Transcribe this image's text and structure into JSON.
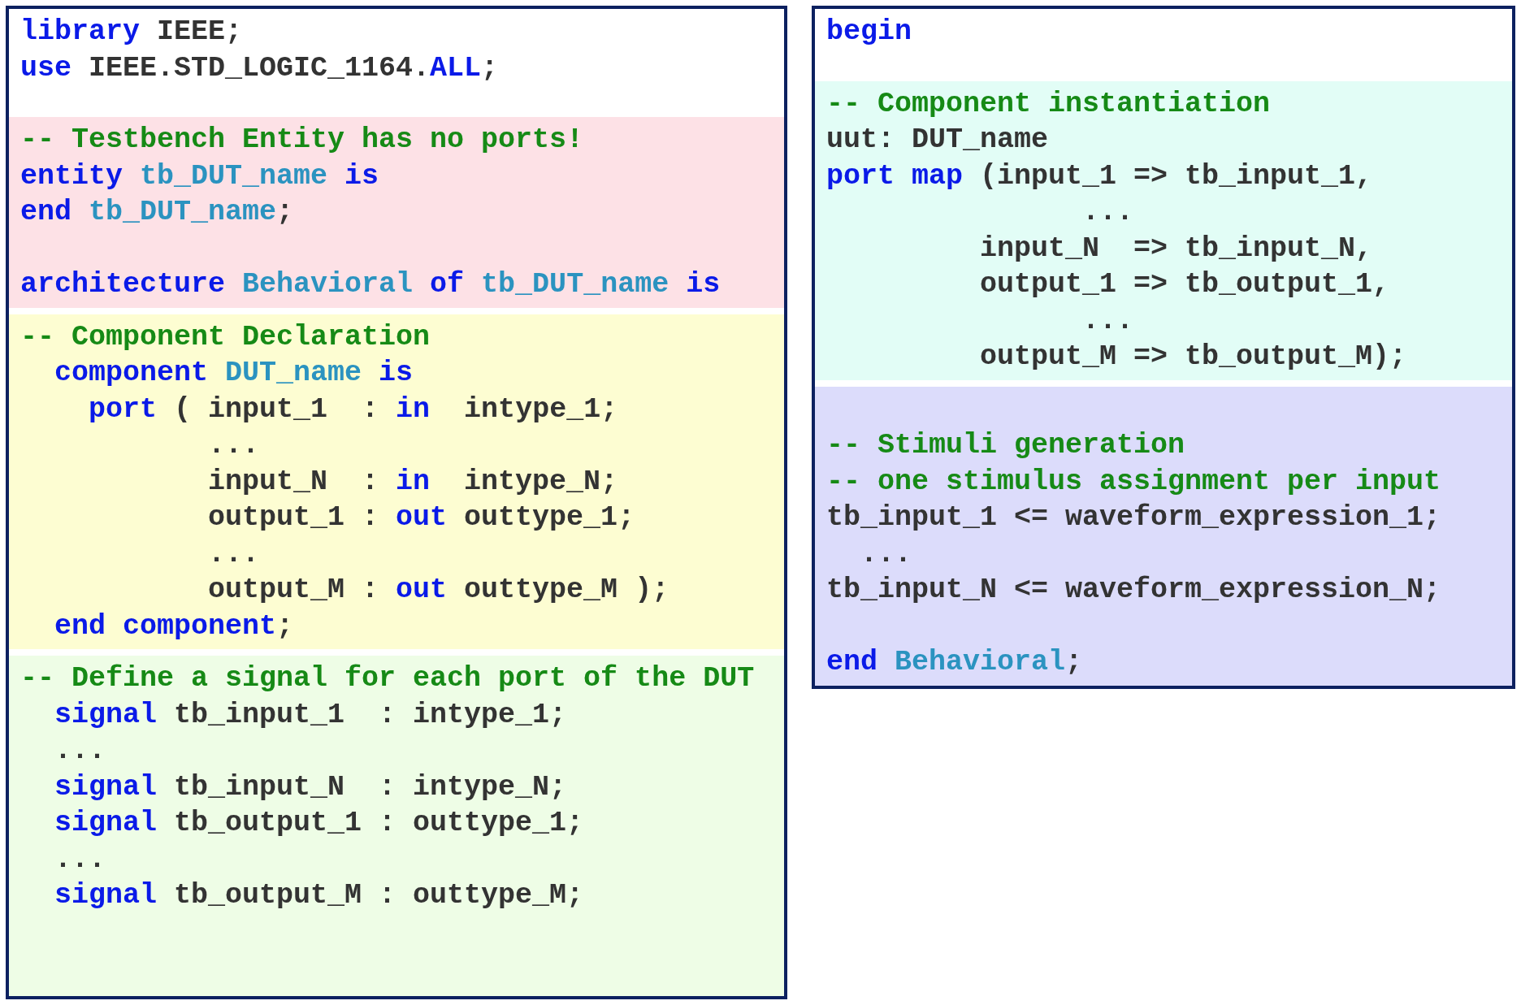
{
  "panels": [
    {
      "sections": [
        {
          "color": "#ffffff",
          "lines": [
            {
              "tokens": [
                {
                  "kind": "keyword",
                  "t": "library "
                },
                {
                  "kind": "text",
                  "t": "IEEE;"
                }
              ]
            },
            {
              "tokens": [
                {
                  "kind": "keyword",
                  "t": "use "
                },
                {
                  "kind": "text",
                  "t": "IEEE.STD_LOGIC_1164."
                },
                {
                  "kind": "keyword",
                  "t": "ALL"
                },
                {
                  "kind": "text",
                  "t": ";"
                }
              ]
            }
          ]
        },
        {
          "color": "#fde1e6",
          "lines": [
            {
              "tokens": [
                {
                  "kind": "comment",
                  "t": "-- Testbench Entity has no ports!"
                }
              ]
            },
            {
              "tokens": [
                {
                  "kind": "keyword",
                  "t": "entity "
                },
                {
                  "kind": "identifier",
                  "t": "tb_DUT_name "
                },
                {
                  "kind": "keyword",
                  "t": "is"
                }
              ]
            },
            {
              "tokens": [
                {
                  "kind": "keyword",
                  "t": "end "
                },
                {
                  "kind": "identifier",
                  "t": "tb_DUT_name"
                },
                {
                  "kind": "text",
                  "t": ";"
                }
              ]
            },
            {
              "space_before": true,
              "tokens": [
                {
                  "kind": "keyword",
                  "t": "architecture "
                },
                {
                  "kind": "identifier",
                  "t": "Behavioral "
                },
                {
                  "kind": "keyword",
                  "t": "of "
                },
                {
                  "kind": "identifier",
                  "t": "tb_DUT_name "
                },
                {
                  "kind": "keyword",
                  "t": "is"
                }
              ]
            }
          ]
        },
        {
          "color": "#fdfdd2",
          "lines": [
            {
              "tokens": [
                {
                  "kind": "comment",
                  "t": "-- Component Declaration"
                }
              ]
            },
            {
              "tokens": [
                {
                  "kind": "keyword",
                  "t": "  component "
                },
                {
                  "kind": "identifier",
                  "t": "DUT_name "
                },
                {
                  "kind": "keyword",
                  "t": "is"
                }
              ]
            },
            {
              "tokens": [
                {
                  "kind": "keyword",
                  "t": "    port"
                },
                {
                  "kind": "text",
                  "t": " ( input_1  : "
                },
                {
                  "kind": "keyword",
                  "t": "in"
                },
                {
                  "kind": "text",
                  "t": "  intype_1;"
                }
              ]
            },
            {
              "tokens": [
                {
                  "kind": "text",
                  "t": "           ..."
                }
              ]
            },
            {
              "tokens": [
                {
                  "kind": "text",
                  "t": "           input_N  : "
                },
                {
                  "kind": "keyword",
                  "t": "in"
                },
                {
                  "kind": "text",
                  "t": "  intype_N;"
                }
              ]
            },
            {
              "tokens": [
                {
                  "kind": "text",
                  "t": "           output_1 : "
                },
                {
                  "kind": "keyword",
                  "t": "out"
                },
                {
                  "kind": "text",
                  "t": " outtype_1;"
                }
              ]
            },
            {
              "tokens": [
                {
                  "kind": "text",
                  "t": "           ..."
                }
              ]
            },
            {
              "tokens": [
                {
                  "kind": "text",
                  "t": "           output_M : "
                },
                {
                  "kind": "keyword",
                  "t": "out"
                },
                {
                  "kind": "text",
                  "t": " outtype_M );"
                }
              ]
            },
            {
              "tokens": [
                {
                  "kind": "keyword",
                  "t": "  end component"
                },
                {
                  "kind": "text",
                  "t": ";"
                }
              ]
            }
          ]
        },
        {
          "color": "#eefde6",
          "lines": [
            {
              "tokens": [
                {
                  "kind": "comment",
                  "t": "-- Define a signal for each port of the DUT"
                }
              ]
            },
            {
              "tokens": [
                {
                  "kind": "keyword",
                  "t": "  signal"
                },
                {
                  "kind": "text",
                  "t": " tb_input_1  : intype_1;"
                }
              ]
            },
            {
              "tokens": [
                {
                  "kind": "text",
                  "t": "  ..."
                }
              ]
            },
            {
              "tokens": [
                {
                  "kind": "keyword",
                  "t": "  signal"
                },
                {
                  "kind": "text",
                  "t": " tb_input_N  : intype_N;"
                }
              ]
            },
            {
              "tokens": [
                {
                  "kind": "keyword",
                  "t": "  signal"
                },
                {
                  "kind": "text",
                  "t": " tb_output_1 : outtype_1;"
                }
              ]
            },
            {
              "tokens": [
                {
                  "kind": "text",
                  "t": "  ..."
                }
              ]
            },
            {
              "tokens": [
                {
                  "kind": "keyword",
                  "t": "  signal"
                },
                {
                  "kind": "text",
                  "t": " tb_output_M : outtype_M;"
                }
              ]
            }
          ]
        }
      ]
    },
    {
      "sections": [
        {
          "color": "#ffffff",
          "lines": [
            {
              "tokens": [
                {
                  "kind": "keyword",
                  "t": "begin"
                }
              ]
            }
          ]
        },
        {
          "color": "#e2fdf6",
          "lines": [
            {
              "tokens": [
                {
                  "kind": "comment",
                  "t": "-- Component instantiation"
                }
              ]
            },
            {
              "tokens": [
                {
                  "kind": "text",
                  "t": "uut: DUT_name"
                }
              ]
            },
            {
              "tokens": [
                {
                  "kind": "keyword",
                  "t": "port map"
                },
                {
                  "kind": "text",
                  "t": " (input_1 => tb_input_1,"
                }
              ]
            },
            {
              "tokens": [
                {
                  "kind": "text",
                  "t": "               ..."
                }
              ]
            },
            {
              "tokens": [
                {
                  "kind": "text",
                  "t": "         input_N  => tb_input_N,"
                }
              ]
            },
            {
              "tokens": [
                {
                  "kind": "text",
                  "t": "         output_1 => tb_output_1,"
                }
              ]
            },
            {
              "tokens": [
                {
                  "kind": "text",
                  "t": "               ..."
                }
              ]
            },
            {
              "tokens": [
                {
                  "kind": "text",
                  "t": "         output_M => tb_output_M);"
                }
              ]
            }
          ]
        },
        {
          "color": "#dcdcfb",
          "lines": [
            {
              "space_before": true,
              "tokens": [
                {
                  "kind": "comment",
                  "t": "-- Stimuli generation"
                }
              ]
            },
            {
              "tokens": [
                {
                  "kind": "comment",
                  "t": "-- one stimulus assignment per input"
                }
              ]
            },
            {
              "tokens": [
                {
                  "kind": "text",
                  "t": "tb_input_1 <= waveform_expression_1;"
                }
              ]
            },
            {
              "tokens": [
                {
                  "kind": "text",
                  "t": "  ..."
                }
              ]
            },
            {
              "tokens": [
                {
                  "kind": "text",
                  "t": "tb_input_N <= waveform_expression_N;"
                }
              ]
            },
            {
              "space_before": true,
              "tokens": [
                {
                  "kind": "keyword",
                  "t": "end "
                },
                {
                  "kind": "identifier",
                  "t": "Behavioral"
                },
                {
                  "kind": "text",
                  "t": ";"
                }
              ]
            }
          ]
        }
      ]
    }
  ]
}
